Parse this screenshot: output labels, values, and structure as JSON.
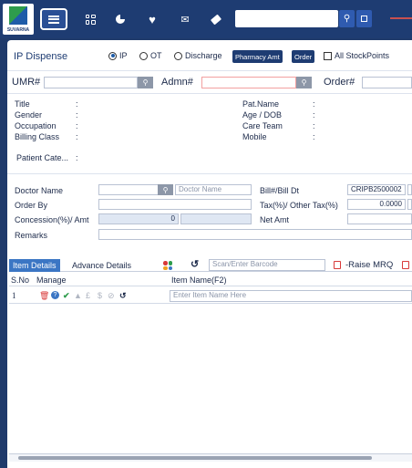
{
  "app": {
    "logo_text": "SUVARNA"
  },
  "topbar": {
    "search_placeholder": ""
  },
  "header": {
    "title": "IP Dispense",
    "radios": [
      {
        "label": "IP",
        "selected": true
      },
      {
        "label": "OT",
        "selected": false
      },
      {
        "label": "Discharge",
        "selected": false
      }
    ],
    "pharmacy_amt_label": "Pharmacy Amt",
    "order_label": "Order",
    "all_stock_label": "All StockPoints",
    "all_stock_checked": false
  },
  "search_row": {
    "umr_label": "UMR#",
    "admn_label": "Admn#",
    "order_label": "Order#"
  },
  "patient": {
    "left_labels": [
      "Title",
      "Gender",
      "Occupation",
      "Billing Class"
    ],
    "right_labels": [
      "Pat.Name",
      "Age / DOB",
      "Care Team",
      "Mobile"
    ],
    "category_label": "Patient Cate...",
    "colon": ":"
  },
  "billing": {
    "doctor_name_label": "Doctor Name",
    "doctor_name_placeholder": "Doctor Name",
    "order_by_label": "Order By",
    "concession_label": "Concession(%)/ Amt",
    "concession_value": "0",
    "remarks_label": "Remarks",
    "bill_label": "Bill#/Bill Dt",
    "bill_value": "CRIPB2500002",
    "tax_label": "Tax(%)/ Other Tax(%)",
    "tax_value": "0.0000",
    "net_amt_label": "Net Amt"
  },
  "items": {
    "tabs": [
      "Item Details",
      "Advance Details"
    ],
    "barcode_placeholder": "Scan/Enter Barcode",
    "raise_mrq_label": "-Raise MRQ",
    "columns": [
      "S.No",
      "Manage",
      "Item Name(F2)"
    ],
    "row_number": "1",
    "item_name_placeholder": "Enter Item Name Here"
  },
  "colors": {
    "primary": "#1e3c72",
    "accent": "#3b76c4",
    "red": "#d83a3a",
    "green": "#2e9c4c"
  }
}
